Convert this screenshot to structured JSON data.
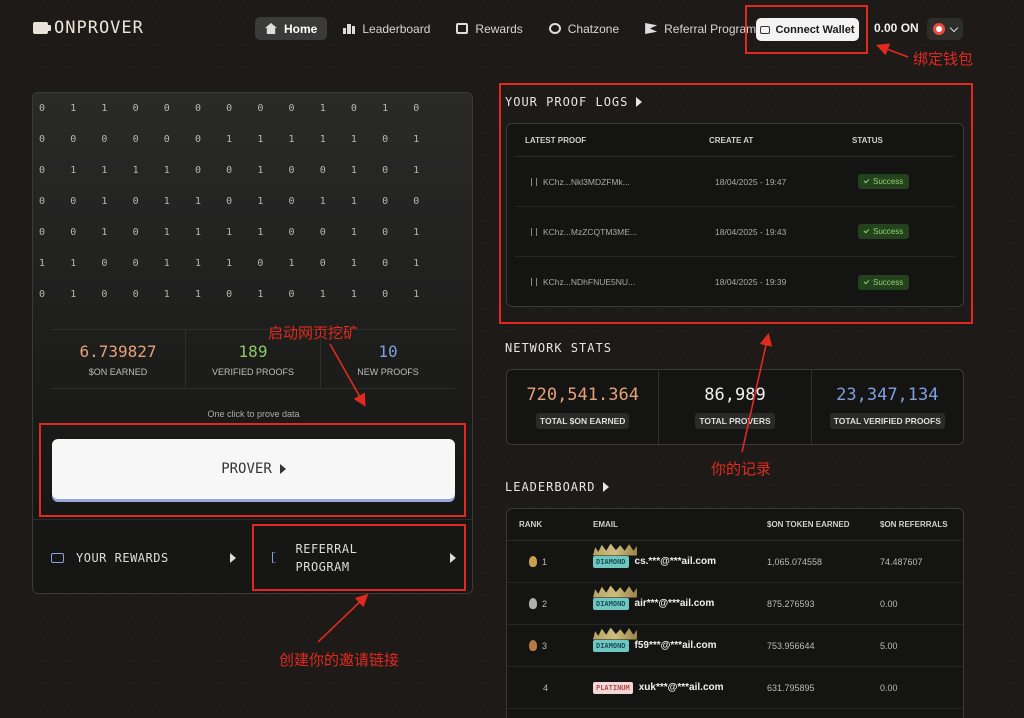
{
  "header": {
    "logo_text": "ONPROVER",
    "nav": [
      {
        "label": "Home",
        "icon": "home-icon",
        "active": true
      },
      {
        "label": "Leaderboard",
        "icon": "leaderboard-icon",
        "active": false
      },
      {
        "label": "Rewards",
        "icon": "gift-icon",
        "active": false
      },
      {
        "label": "Chatzone",
        "icon": "chat-icon",
        "active": false
      },
      {
        "label": "Referral Program",
        "icon": "flag-icon",
        "active": false
      }
    ],
    "connect_wallet_label": "Connect Wallet",
    "balance": "0.00 ON"
  },
  "annotations": {
    "bind_wallet": "绑定钱包",
    "start_mining": "启动网页挖矿",
    "your_records": "你的记录",
    "create_invite": "创建你的邀请链接"
  },
  "mining": {
    "bit_grid": [
      "0110000001010",
      "0000001111101",
      "0111100100101",
      "0010110101100",
      "0010111100101",
      "1100111010101",
      "0100110101101"
    ],
    "stats": [
      {
        "value": "6.739827",
        "label": "$ON EARNED",
        "color": "#e8a07a"
      },
      {
        "value": "189",
        "label": "VERIFIED PROOFS",
        "color": "#8fc96a"
      },
      {
        "value": "10",
        "label": "NEW PROOFS",
        "color": "#7d9fe0"
      }
    ],
    "one_click_text": "One click to prove data",
    "prover_label": "PROVER"
  },
  "bottom_links": {
    "rewards_label": "YOUR REWARDS",
    "referral_label_line1": "REFERRAL",
    "referral_label_line2": "PROGRAM"
  },
  "proof_logs": {
    "title": "YOUR PROOF LOGS",
    "columns": [
      "LATEST PROOF",
      "CREATE AT",
      "STATUS"
    ],
    "rows": [
      {
        "proof": "KChz...Nkl3MDZFMk...",
        "created": "18/04/2025 - 19:47",
        "status": "Success"
      },
      {
        "proof": "KChz...MzZCQTM3ME...",
        "created": "18/04/2025 - 19:43",
        "status": "Success"
      },
      {
        "proof": "KChz...NDhFNUE5NU...",
        "created": "18/04/2025 - 19:39",
        "status": "Success"
      }
    ]
  },
  "network_stats": {
    "title": "NETWORK STATS",
    "items": [
      {
        "value": "720,541.364",
        "label": "TOTAL $ON EARNED",
        "color": "#e8a07a"
      },
      {
        "value": "86,989",
        "label": "TOTAL PROVERS",
        "color": "#f0f0f0"
      },
      {
        "value": "23,347,134",
        "label": "TOTAL VERIFIED PROOFS",
        "color": "#7d9fe0"
      }
    ]
  },
  "leaderboard": {
    "title": "LEADERBOARD",
    "columns": [
      "RANK",
      "EMAIL",
      "$ON TOKEN EARNED",
      "$ON REFERRALS"
    ],
    "rows": [
      {
        "rank": "1",
        "medal": "gold",
        "tier": "DIAMOND",
        "email": "cs.***@***ail.com",
        "earned": "1,065.074558",
        "referrals": "74.487607"
      },
      {
        "rank": "2",
        "medal": "silver",
        "tier": "DIAMOND",
        "email": "air***@***ail.com",
        "earned": "875.276593",
        "referrals": "0.00"
      },
      {
        "rank": "3",
        "medal": "bronze",
        "tier": "DIAMOND",
        "email": "f59***@***ail.com",
        "earned": "753.956644",
        "referrals": "5.00"
      },
      {
        "rank": "4",
        "medal": "",
        "tier": "PLATINUM",
        "email": "xuk***@***ail.com",
        "earned": "631.795895",
        "referrals": "0.00"
      }
    ]
  }
}
